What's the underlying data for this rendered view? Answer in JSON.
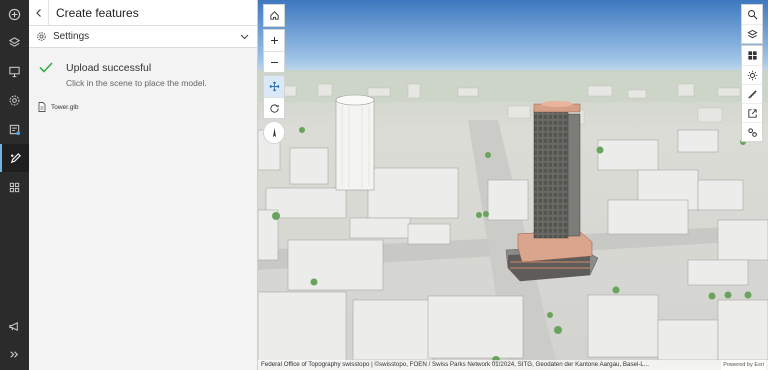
{
  "panel": {
    "title": "Create features",
    "settings_label": "Settings",
    "status": {
      "title": "Upload successful",
      "description": "Click in the scene to place the model."
    },
    "file_name": "Tower.glb"
  },
  "rail": {
    "items": [
      {
        "icon": "plus-circle-icon"
      },
      {
        "icon": "layers-icon"
      },
      {
        "icon": "presentation-icon"
      },
      {
        "icon": "gear-icon"
      },
      {
        "icon": "legend-icon"
      },
      {
        "icon": "edit-features-icon",
        "active": true
      },
      {
        "icon": "grid-icon"
      }
    ],
    "bottom": [
      {
        "icon": "megaphone-icon"
      },
      {
        "icon": "expand-icon"
      }
    ]
  },
  "map": {
    "attribution": "Federal Office of Topography swisstopo | ©swisstopo, FOEN / Swiss Parks Network 01/2024, SITG, Geodaten der Kantone Aargau, Basel-L...",
    "powered_by": "Powered by Esri"
  },
  "colors": {
    "accent": "#35ac46",
    "rail": "#2b2b2b",
    "panel": "#f3f3f3",
    "sky_top": "#3d78c0",
    "active_tool": "#dbe9f7"
  }
}
